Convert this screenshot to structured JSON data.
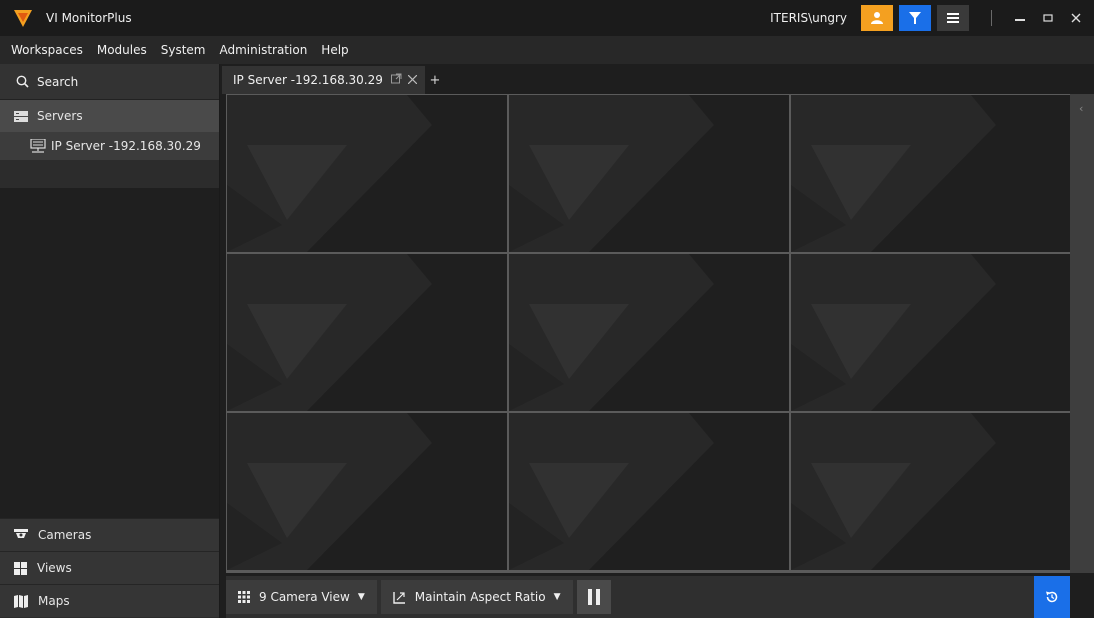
{
  "app": {
    "title": "VI MonitorPlus",
    "username": "ITERIS\\ungry"
  },
  "menu": [
    "Workspaces",
    "Modules",
    "System",
    "Administration",
    "Help"
  ],
  "sidebar": {
    "search_label": "Search",
    "servers_label": "Servers",
    "tree_items": [
      "IP Server -192.168.30.29"
    ],
    "bottom_tabs": [
      "Cameras",
      "Views",
      "Maps"
    ]
  },
  "tabs": [
    {
      "label": "IP Server -192.168.30.29"
    }
  ],
  "tab_add": "+",
  "toolbar": {
    "layout_label": "9 Camera View",
    "aspect_label": "Maintain Aspect Ratio"
  },
  "colors": {
    "accent_blue": "#1a6fe8",
    "accent_orange": "#f4a020",
    "background": "#1e1e1e"
  }
}
